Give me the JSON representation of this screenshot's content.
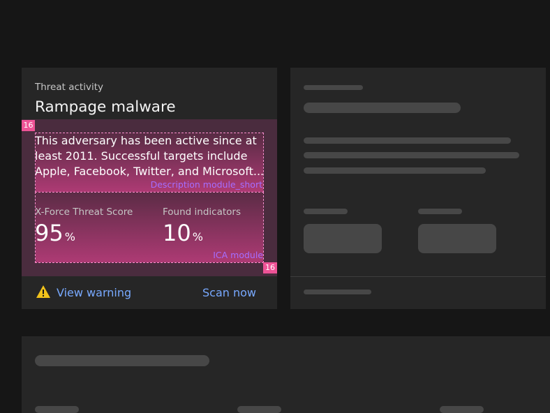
{
  "card": {
    "eyebrow": "Threat activity",
    "title": "Rampage malware",
    "description_lines": [
      "This adversary has been active since at",
      "least 2011. Successful targets include",
      "Apple, Facebook, Twitter, and Microsoft..."
    ],
    "stats": [
      {
        "label": "X-Force Threat Score",
        "value": "95",
        "unit": "%"
      },
      {
        "label": "Found indicators",
        "value": "10",
        "unit": "%"
      }
    ],
    "footer": {
      "warning_label": "View warning",
      "action_label": "Scan now",
      "warning_icon": "warning-triangle-icon"
    }
  },
  "spec_overlay": {
    "spacing_top": "16",
    "spacing_bottom": "16",
    "module_labels": [
      "Description module_short",
      "ICA module"
    ]
  },
  "colors": {
    "background": "#161616",
    "card": "#262626",
    "link": "#78a9ff",
    "spec_magenta": "#ee5396",
    "spec_label": "#a56eff",
    "skeleton": "#474747",
    "warning": "#f1c21b"
  }
}
